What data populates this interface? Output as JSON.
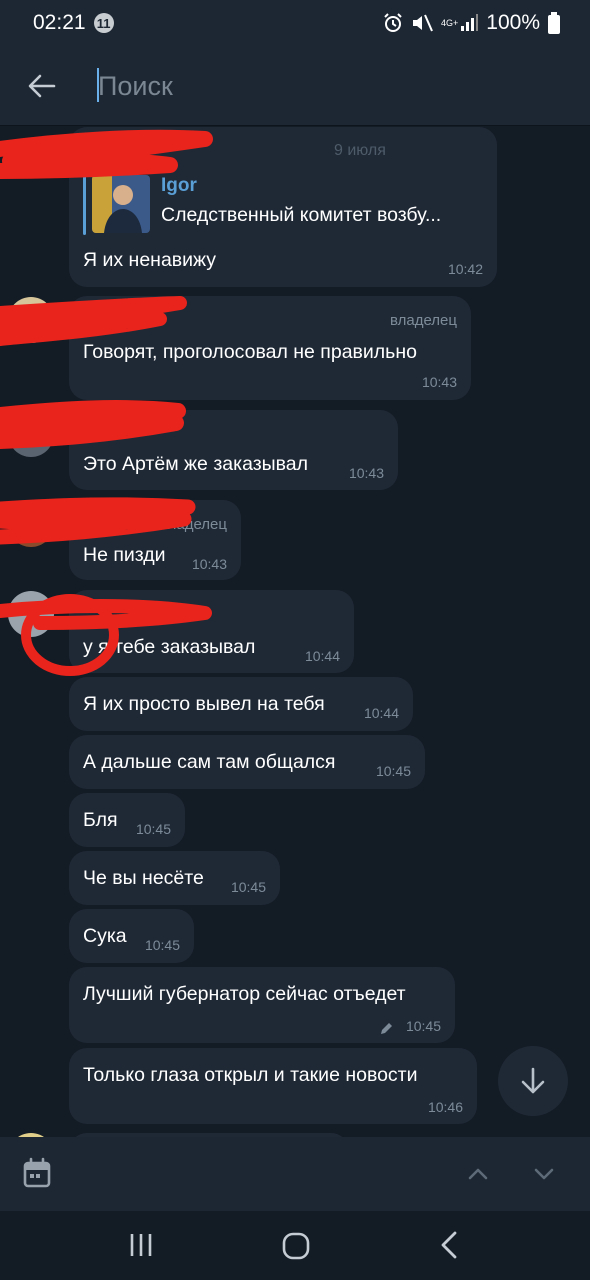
{
  "status_bar": {
    "time": "02:21",
    "notification_count": "11",
    "network": "4G+",
    "battery": "100%"
  },
  "search": {
    "placeholder": "Поиск",
    "value": ""
  },
  "chat": {
    "date": "9 июля",
    "messages": [
      {
        "reply": {
          "name": "Igor",
          "text": "Следственный комитет возбу..."
        },
        "text": "Я их ненавижу",
        "time": "10:42"
      },
      {
        "role": "владелец",
        "text": "Говорят, проголосовал не правильно",
        "time": "10:43"
      },
      {
        "text": "Это Артём же заказывал",
        "time": "10:43"
      },
      {
        "role": "владелец",
        "text": "Не пизди",
        "time": "10:43"
      },
      {
        "text": "у я тебе заказывал",
        "time": "10:44"
      },
      {
        "text": "Я их просто вывел на тебя",
        "time": "10:44"
      },
      {
        "text": "А дальше сам там общался",
        "time": "10:45"
      },
      {
        "text": "Бля",
        "time": "10:45"
      },
      {
        "text": "Че вы несёте",
        "time": "10:45"
      },
      {
        "text": "Сука",
        "time": "10:45"
      },
      {
        "text": "Лучший губернатор сейчас отъедет",
        "time": "10:45",
        "edited": true
      },
      {
        "text": "Только глаза открыл и такие новости",
        "time": "10:46"
      }
    ]
  },
  "icons": {
    "back": "arrow-left-icon",
    "scroll_down": "arrow-down-icon",
    "calendar": "calendar-icon",
    "prev_result": "chevron-up-icon",
    "next_result": "chevron-down-icon",
    "edited": "pencil-icon"
  },
  "colors": {
    "background": "#131b24",
    "bar": "#1d2733",
    "bubble": "#1f2936",
    "accent": "#5a9fd6",
    "redaction": "#e8241c"
  }
}
